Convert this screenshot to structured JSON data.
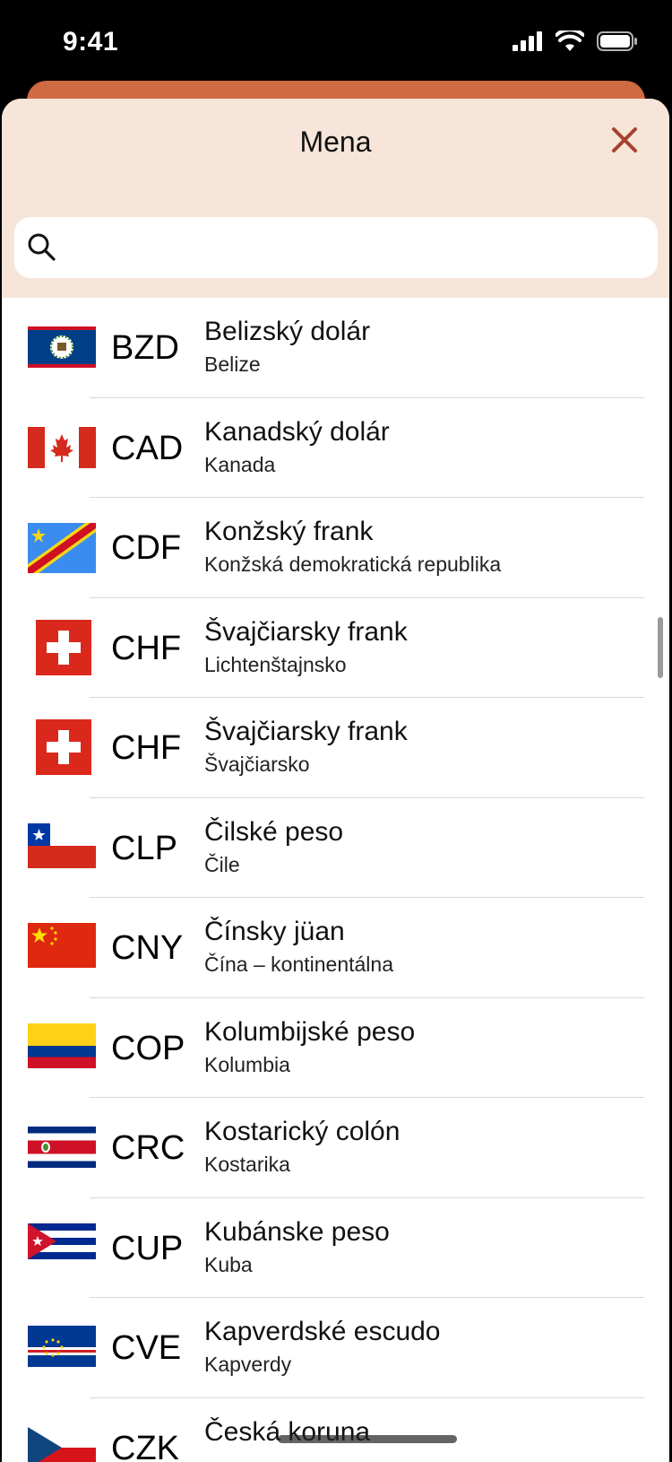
{
  "status": {
    "time": "9:41"
  },
  "sheet": {
    "title": "Mena",
    "search_placeholder": ""
  },
  "currencies": [
    {
      "code": "BZD",
      "name": "Belizský dolár",
      "country": "Belize",
      "flag": "flag-belize"
    },
    {
      "code": "CAD",
      "name": "Kanadský dolár",
      "country": "Kanada",
      "flag": "flag-canada"
    },
    {
      "code": "CDF",
      "name": "Konžský frank",
      "country": "Konžská demokratická republika",
      "flag": "flag-dr-congo"
    },
    {
      "code": "CHF",
      "name": "Švajčiarsky frank",
      "country": "Lichtenštajnsko",
      "flag": "flag-switzerland"
    },
    {
      "code": "CHF",
      "name": "Švajčiarsky frank",
      "country": "Švajčiarsko",
      "flag": "flag-switzerland"
    },
    {
      "code": "CLP",
      "name": "Čilské peso",
      "country": "Čile",
      "flag": "flag-chile"
    },
    {
      "code": "CNY",
      "name": "Čínsky jüan",
      "country": "Čína – kontinentálna",
      "flag": "flag-china"
    },
    {
      "code": "COP",
      "name": "Kolumbijské peso",
      "country": "Kolumbia",
      "flag": "flag-colombia"
    },
    {
      "code": "CRC",
      "name": "Kostarický colón",
      "country": "Kostarika",
      "flag": "flag-costa-rica"
    },
    {
      "code": "CUP",
      "name": "Kubánske peso",
      "country": "Kuba",
      "flag": "flag-cuba"
    },
    {
      "code": "CVE",
      "name": "Kapverdské escudo",
      "country": "Kapverdy",
      "flag": "flag-cape-verde"
    },
    {
      "code": "CZK",
      "name": "Česká koruna",
      "country": "",
      "flag": "flag-czechia"
    }
  ],
  "colors": {
    "accent": "#a8412f",
    "header_bg": "#f7e5da",
    "behind_card": "#cf6a43"
  }
}
